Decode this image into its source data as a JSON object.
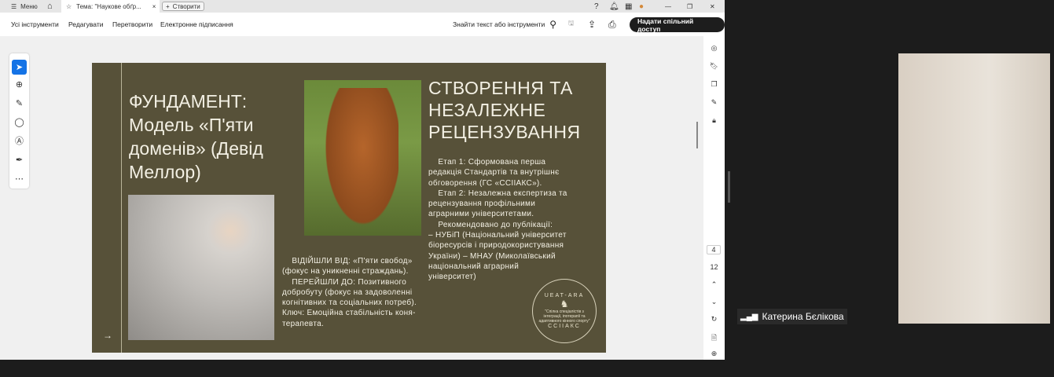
{
  "tabbar": {
    "menu": "Меню",
    "tab_title": "Тема: \"Наукове обґр...",
    "create": "Створити"
  },
  "toolbar": {
    "items": [
      "Усі інструменти",
      "Редагувати",
      "Перетворити",
      "Електронне підписання"
    ],
    "search": "Знайти текст або інструменти",
    "share": "Надати спільний доступ"
  },
  "slide": {
    "title_left": "ФУНДАМЕНТ: Модель «П'яти доменів» (Девід Меллор)",
    "title_right": "СТВОРЕННЯ ТА НЕЗАЛЕЖНЕ РЕЦЕНЗУВАННЯ",
    "left_text": "    ВІДІЙШЛИ ВІД: «П'яти свобод» (фокус на уникненні страждань).\n    ПЕРЕЙШЛИ ДО: Позитивного добробуту (фокус на задоволенні когнітивних та соціальних потреб). Ключ: Емоційна стабільність коня-терапевта.",
    "right_text": "    Етап 1: Сформована перша редакція Стандартів та внутрішнє обговорення (ГС «ССІІАКС»).\n    Етап 2: Незалежна експертиза та рецензування профільними аграрними університетами.\n    Рекомендовано до публікації:\n– НУБіП (Національний університет біоресурсів і природокористування України) – МНАУ (Миколаївський національний аграрний університет)",
    "seal_top": "UEAT-ARA",
    "seal_mid": "\"Спілка спеціалістів з інтеграції, іпотерапії та адаптивного кінного спорту\"",
    "seal_bottom": "ССІІАКС",
    "arrow": "→"
  },
  "pager": {
    "current": "4",
    "total": "12"
  },
  "participant": {
    "name": "Катерина Бєлікова"
  }
}
